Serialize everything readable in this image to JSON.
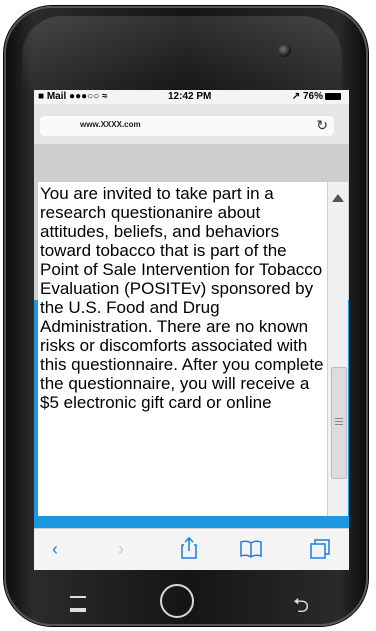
{
  "status_bar": {
    "carrier": "■ Mail ●●●○○ ≈",
    "time": "12:42 PM",
    "battery": "↗ 76%"
  },
  "browser": {
    "url": "www.XXXX.com",
    "reload_icon": "reload-icon"
  },
  "consent_text": "You are invited to take part in a research questionanire about attitudes, beliefs, and behaviors toward tobacco that is part of the Point of Sale Intervention for Tobacco Evaluation (POSITEv) sponsored by the U.S. Food and Drug Administration. There are no known risks or discomforts associated with this questionnaire. After you complete the questionnaire, you will receive a $5 electronic gift card or online",
  "toolbar": {
    "icons": [
      "back-icon",
      "forward-icon",
      "share-icon",
      "bookmarks-icon",
      "tabs-icon"
    ]
  },
  "colors": {
    "accent": "#1a98e0",
    "toolbar_icon": "#1a7fe0"
  }
}
